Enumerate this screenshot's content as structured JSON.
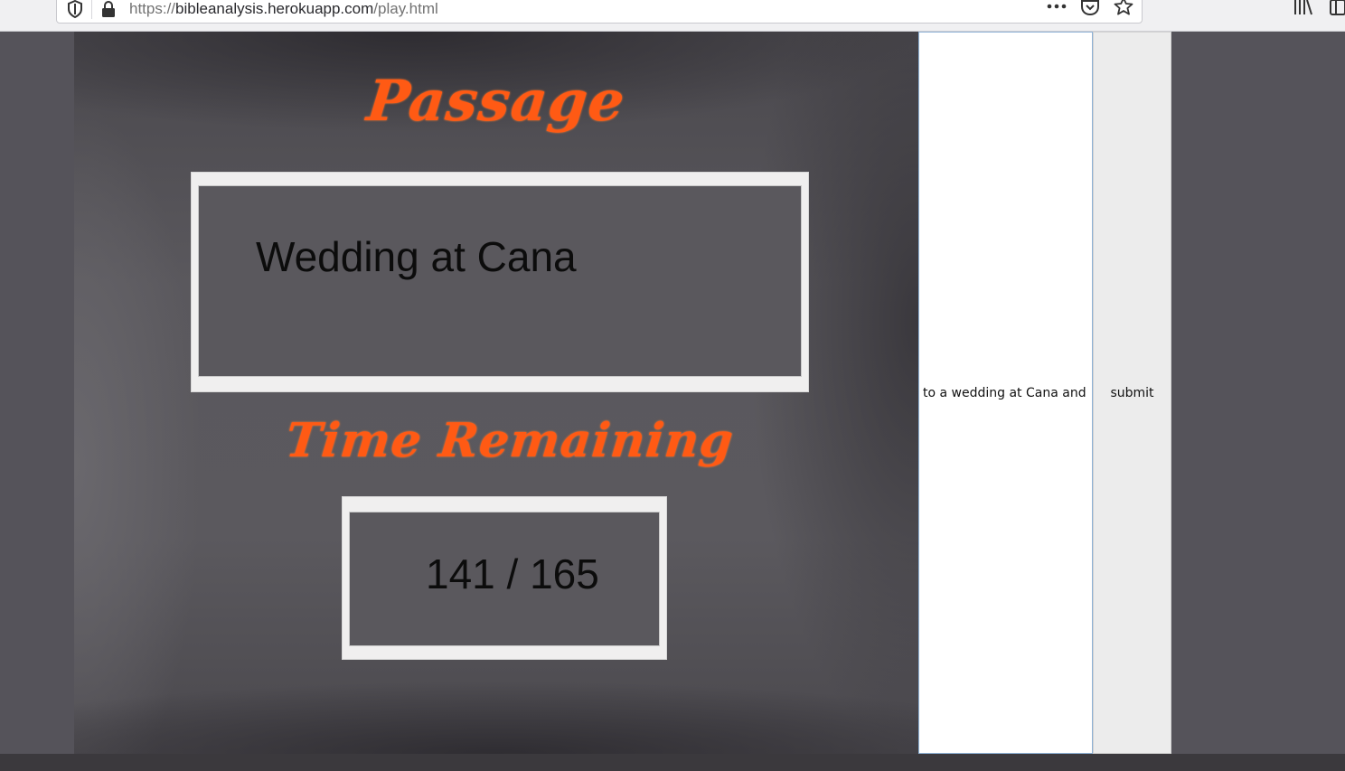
{
  "browser": {
    "url_scheme": "https://",
    "url_host": "bibleanalysis.herokuapp.com",
    "url_path": "/play.html",
    "icons": [
      "shield-icon",
      "lock-icon",
      "more-icon",
      "pocket-icon",
      "bookmark-star-icon",
      "library-icon",
      "sidebar-icon"
    ]
  },
  "game": {
    "passage_heading": "Passage",
    "passage_title": "Wedding at Cana",
    "time_heading": "Time Remaining",
    "time_remaining": "141 / 165"
  },
  "answer": {
    "value": "to a wedding at Cana and"
  },
  "submit": {
    "label": "submit"
  },
  "colors": {
    "heading": "#ff5a14",
    "background": "#55535a"
  }
}
